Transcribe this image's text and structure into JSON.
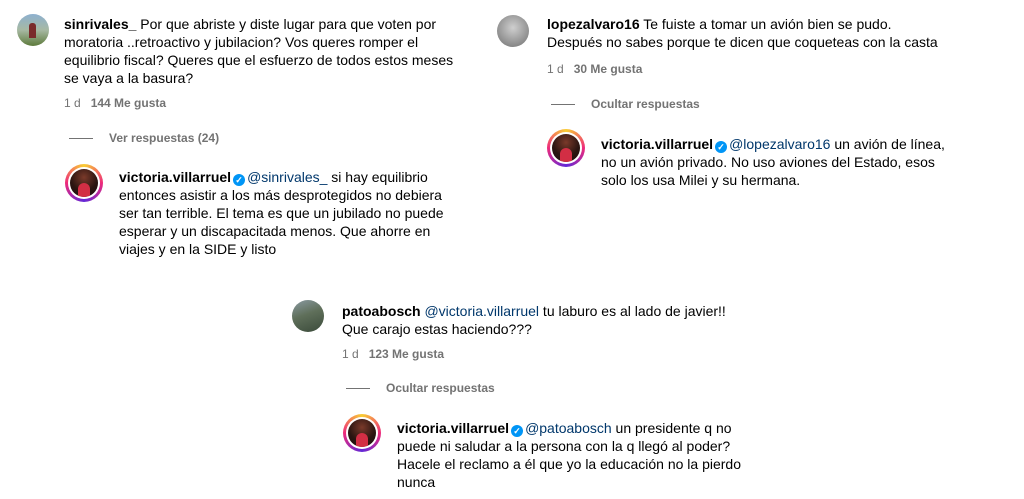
{
  "comments": [
    {
      "username": "sinrivales_",
      "text": " Por que abriste y diste lugar para que voten por moratoria ..retroactivo y jubilacion? Vos queres romper el equilibrio fiscal? Queres que el esfuerzo de todos estos meses se vaya a la basura?",
      "time": "1 d",
      "likes": "144 Me gusta",
      "toggle": "Ver respuestas (24)",
      "reply": {
        "username": "victoria.villarruel",
        "verified_icon": "verified-badge-icon",
        "mention": "@sinrivales_",
        "text": " si hay equilibrio entonces asistir a los más desprotegidos no debiera ser tan terrible. El tema es que un jubilado no puede esperar y un discapacitada menos. Que ahorre en viajes y en la SIDE y listo"
      }
    },
    {
      "username": "lopezalvaro16",
      "text": " Te fuiste a tomar un avión bien se pudo. Después no sabes porque te dicen que coqueteas con la casta",
      "time": "1 d",
      "likes": "30 Me gusta",
      "toggle": "Ocultar respuestas",
      "reply": {
        "username": "victoria.villarruel",
        "verified_icon": "verified-badge-icon",
        "mention": "@lopezalvaro16",
        "text": " un avión de línea, no un avión privado. No uso aviones del Estado, esos solo los usa Milei y su hermana."
      }
    },
    {
      "username": "patoabosch",
      "mention": "@victoria.villarruel",
      "text": " tu laburo es al lado de javier!! Que carajo estas haciendo???",
      "time": "1 d",
      "likes": "123 Me gusta",
      "toggle": "Ocultar respuestas",
      "reply": {
        "username": "victoria.villarruel",
        "verified_icon": "verified-badge-icon",
        "mention": "@patoabosch",
        "text": " un presidente q no puede ni saludar a la persona con la q llegó al poder? Hacele el reclamo a él que yo la educación no la pierdo nunca"
      }
    }
  ]
}
